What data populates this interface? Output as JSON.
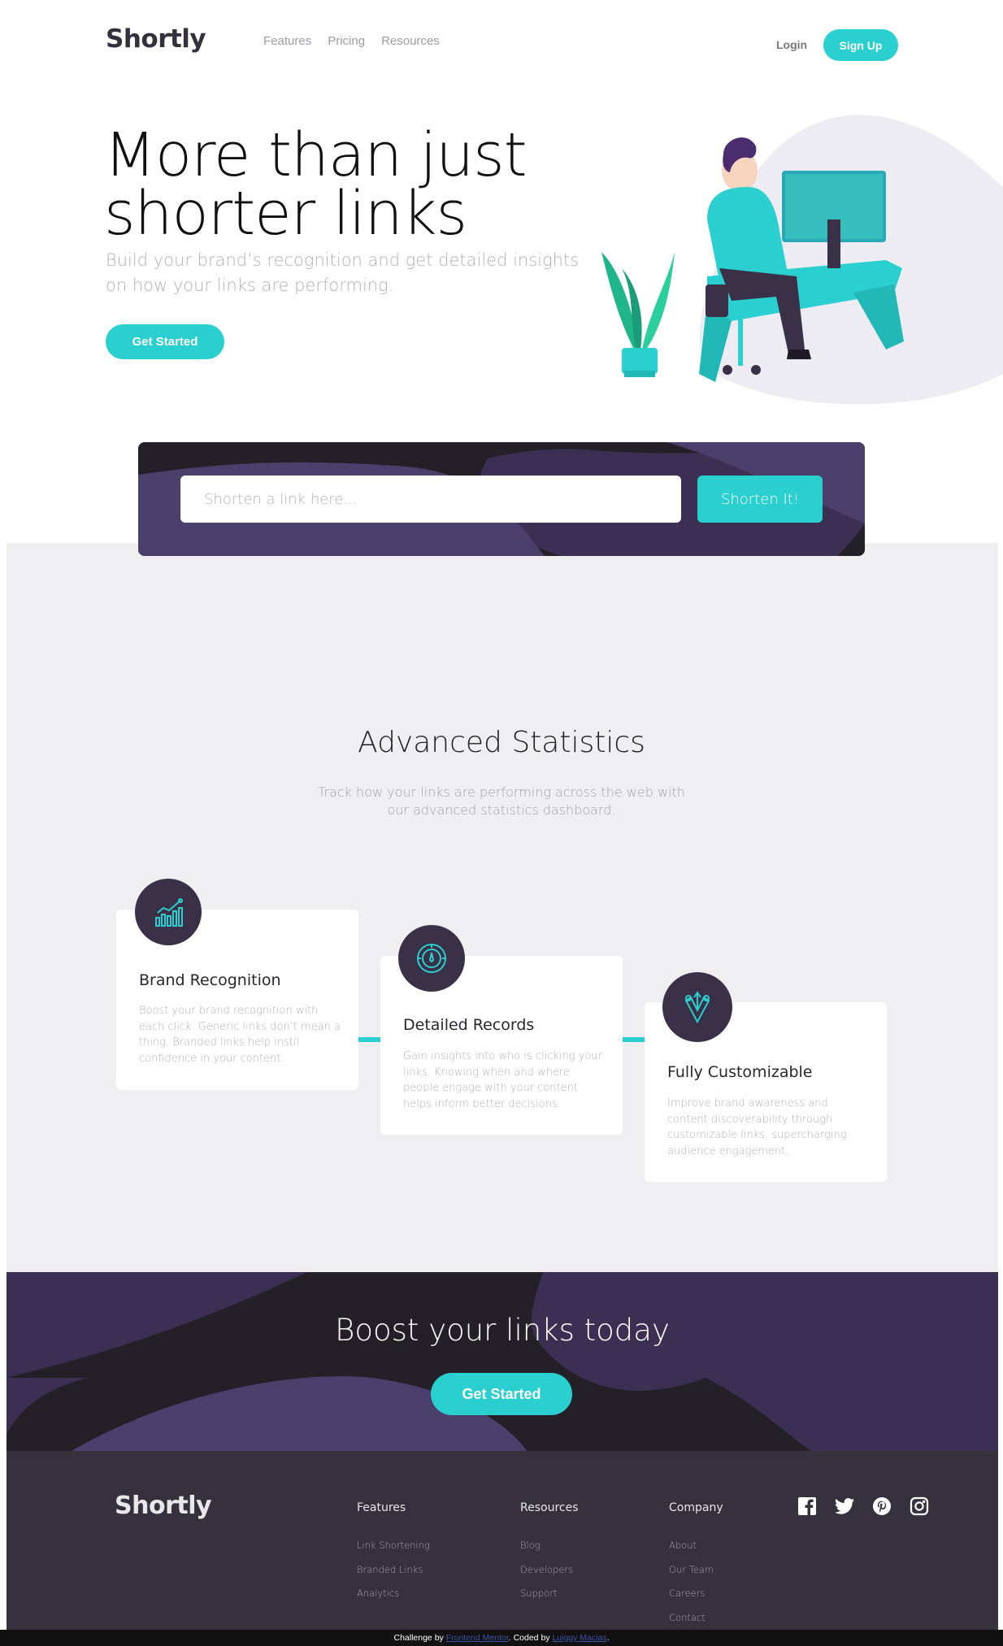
{
  "header": {
    "logo": "Shortly",
    "nav": [
      "Features",
      "Pricing",
      "Resources"
    ],
    "login": "Login",
    "signup": "Sign Up"
  },
  "hero": {
    "title_line1": "More than just",
    "title_line2": "shorter links",
    "subtitle": "Build your brand’s recognition and get detailed insights on how your links are performing.",
    "cta": "Get Started"
  },
  "shorten": {
    "placeholder": "Shorten a link here...",
    "button": "Shorten It!"
  },
  "stats": {
    "title": "Advanced Statistics",
    "subtitle": "Track how your links are performing across the web with our advanced statistics dashboard.",
    "cards": [
      {
        "title": "Brand Recognition",
        "text": "Boost your brand recognition with each click. Generic links don’t mean a thing. Branded links help instil confidence in your content.",
        "icon": "chart-icon"
      },
      {
        "title": "Detailed Records",
        "text": "Gain insights into who is clicking your links. Knowing when and where people engage with your content helps inform better decisions.",
        "icon": "gauge-icon"
      },
      {
        "title": "Fully Customizable",
        "text": "Improve brand awareness and content discoverability through customizable links, supercharging audience engagement.",
        "icon": "pens-icon"
      }
    ]
  },
  "boost": {
    "title": "Boost your links today",
    "cta": "Get Started"
  },
  "footer": {
    "logo": "Shortly",
    "columns": [
      {
        "heading": "Features",
        "links": [
          "Link Shortening",
          "Branded Links",
          "Analytics"
        ]
      },
      {
        "heading": "Resources",
        "links": [
          "Blog",
          "Developers",
          "Support"
        ]
      },
      {
        "heading": "Company",
        "links": [
          "About",
          "Our Team",
          "Careers",
          "Contact"
        ]
      }
    ],
    "socials": [
      "facebook-icon",
      "twitter-icon",
      "pinterest-icon",
      "instagram-icon"
    ]
  },
  "attribution": {
    "prefix": "Challenge by ",
    "link1": "Frontend Mentor",
    "middle": ". Coded by ",
    "link2": "Luiggy Macias",
    "suffix": "."
  },
  "colors": {
    "accent": "#2acfcf",
    "dark_violet": "#3b3054",
    "footer": "#35323e",
    "gray_bg": "#efeff1"
  }
}
